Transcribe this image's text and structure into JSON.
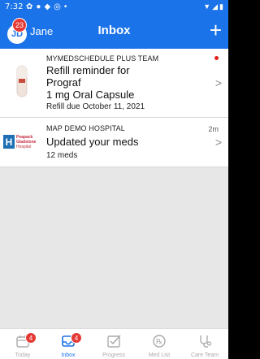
{
  "statusbar": {
    "time": "7:32"
  },
  "header": {
    "avatar_initials": "JD",
    "avatar_badge": "23",
    "user_name": "Jane",
    "title": "Inbox",
    "add_label": "+"
  },
  "messages": [
    {
      "sender": "MYMEDSCHEDULE PLUS TEAM",
      "title_lines": [
        "Refill reminder for",
        "Prograf",
        "1 mg Oral Capsule"
      ],
      "detail": "Refill due October 11, 2021",
      "unread": true
    },
    {
      "sender": "MAP DEMO HOSPITAL",
      "time": "2m",
      "title": "Updated your meds",
      "detail": "12 meds",
      "logo_letter": "H",
      "logo_text": [
        "Peapack",
        "Gladstone",
        "Hospital"
      ]
    }
  ],
  "tabs": [
    {
      "label": "Today",
      "icon": "calendar-icon",
      "badge": "4"
    },
    {
      "label": "Inbox",
      "icon": "inbox-icon",
      "badge": "4",
      "active": true
    },
    {
      "label": "Progress",
      "icon": "check-square-icon"
    },
    {
      "label": "Med List",
      "icon": "pill-list-icon"
    },
    {
      "label": "Care Team",
      "icon": "stethoscope-icon"
    }
  ],
  "colors": {
    "primary": "#1a73e8",
    "badge": "#e53935",
    "unread_dot": "#e0201c"
  }
}
